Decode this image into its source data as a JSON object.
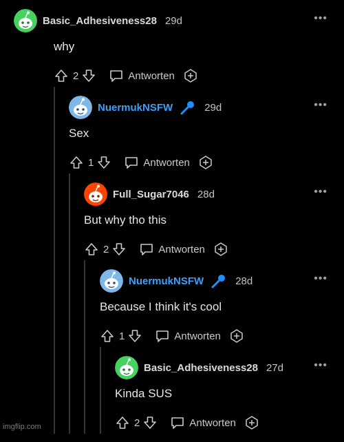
{
  "comments": [
    {
      "username": "Basic_Adhesiveness28",
      "age": "29d",
      "body": "why",
      "votes": "2",
      "reply_label": "Antworten",
      "avatar": "green-snoo-avatar",
      "name_color": "#d7dadc",
      "mic": false
    },
    {
      "username": "NuermukNSFW",
      "age": "29d",
      "body": "Sex",
      "votes": "1",
      "reply_label": "Antworten",
      "avatar": "blue-snoo-avatar",
      "name_color": "#3d9ff5",
      "mic": true
    },
    {
      "username": "Full_Sugar7046",
      "age": "28d",
      "body": "But why tho this",
      "votes": "2",
      "reply_label": "Antworten",
      "avatar": "red-snoo-avatar",
      "name_color": "#d7dadc",
      "mic": false
    },
    {
      "username": "NuermukNSFW",
      "age": "28d",
      "body": "Because I think it's cool",
      "votes": "1",
      "reply_label": "Antworten",
      "avatar": "blue-snoo-avatar",
      "name_color": "#3d9ff5",
      "mic": true
    },
    {
      "username": "Basic_Adhesiveness28",
      "age": "27d",
      "body": "Kinda SUS",
      "votes": "2",
      "reply_label": "Antworten",
      "avatar": "green-snoo-avatar",
      "name_color": "#d7dadc",
      "mic": false
    }
  ],
  "more_label": "•••",
  "watermark": "imgflip.com",
  "colors": {
    "background": "#000000",
    "thread_line": "#343536",
    "text": "#d7dadc",
    "mod_blue": "#3d9ff5",
    "mic_blue": "#1e90ff"
  }
}
